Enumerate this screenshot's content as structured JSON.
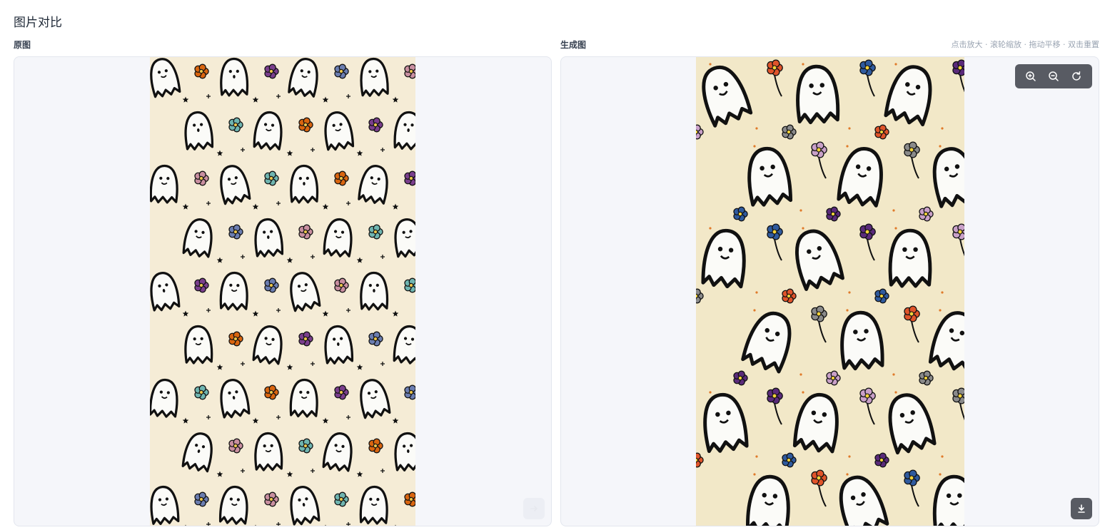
{
  "page": {
    "title": "图片对比"
  },
  "original": {
    "label": "原图",
    "background_color": "#f5ecd6",
    "export_icon": "share-icon"
  },
  "generated": {
    "label": "生成图",
    "background_color": "#f2e8c8",
    "hint": "点击放大 · 滚轮缩放 · 拖动平移 · 双击重置",
    "toolbar": {
      "zoom_in_icon": "zoom-in-icon",
      "zoom_out_icon": "zoom-out-icon",
      "reset_icon": "reset-icon"
    },
    "download_icon": "download-icon"
  },
  "colors": {
    "panel_bg": "#f5f6fa",
    "panel_border": "#e3e6ee",
    "toolbar_bg": "#3c4048"
  }
}
